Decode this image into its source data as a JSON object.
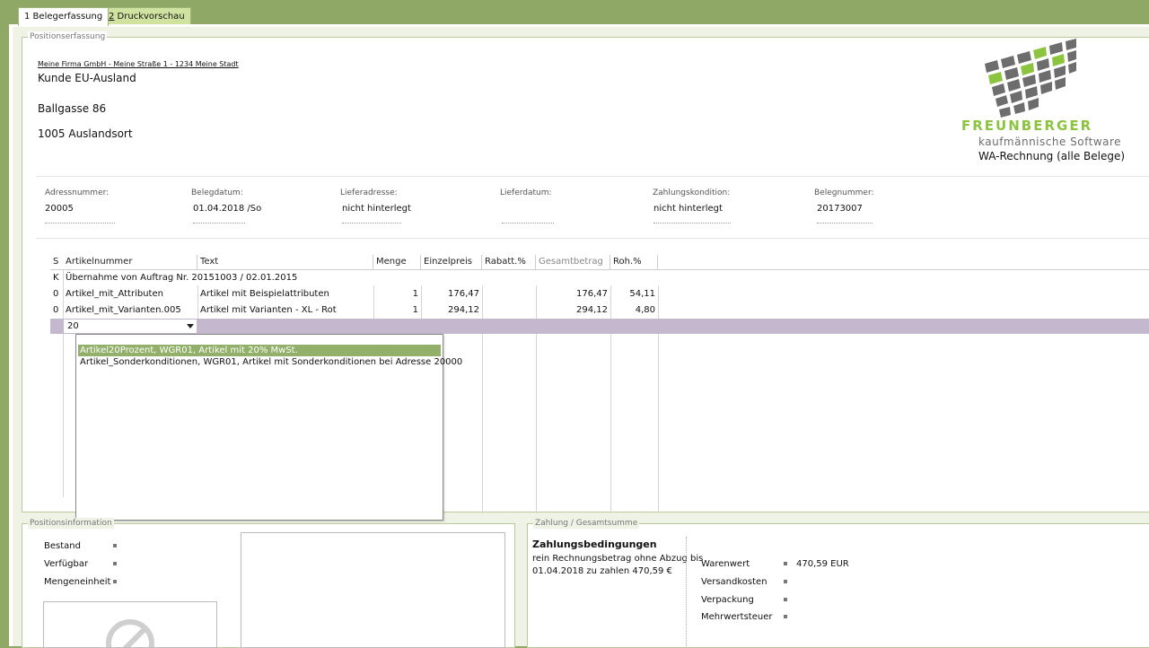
{
  "tabs": [
    {
      "hotkey": "1",
      "label": " Belegerfassung"
    },
    {
      "hotkey": "2",
      "label": " Druckvorschau"
    }
  ],
  "positionserfassung": {
    "title": "Positionserfassung",
    "sender_line": "Meine Firma GmbH - Meine Straße 1 - 1234 Meine Stadt",
    "customer_name": "Kunde EU-Ausland",
    "street": "Ballgasse 86",
    "city": "1005 Auslandsort",
    "logo": {
      "brand": "FREUNBERGER",
      "tagline": "kaufmännische Software",
      "colors": {
        "green": "#8cc43f",
        "grey": "#6d6d6d"
      }
    },
    "document_type": "WA-Rechnung (alle Belege)",
    "fields": [
      {
        "label": "Adressnummer:",
        "value": "20005"
      },
      {
        "label": "Belegdatum:",
        "value": "01.04.2018 /So"
      },
      {
        "label": "Lieferadresse:",
        "value": "nicht hinterlegt"
      },
      {
        "label": "Lieferdatum:",
        "value": ""
      },
      {
        "label": "Zahlungskondition:",
        "value": "nicht hinterlegt"
      },
      {
        "label": "Belegnummer:",
        "value": "20173007"
      }
    ]
  },
  "table": {
    "columns": [
      "S",
      "Artikelnummer",
      "Text",
      "Menge",
      "Einzelpreis",
      "Rabatt.%",
      "Gesamtbetrag",
      "Roh.%"
    ],
    "rows": [
      {
        "s": "K",
        "artikelnummer": "Übernahme von Auftrag Nr. 20151003 / 02.01.2015",
        "text": "",
        "menge": "",
        "einzelpreis": "",
        "rabatt": "",
        "gesamt": "",
        "roh": ""
      },
      {
        "s": "0",
        "artikelnummer": "Artikel_mit_Attributen",
        "text": "Artikel mit Beispielattributen",
        "menge": "1",
        "einzelpreis": "176,47",
        "rabatt": "",
        "gesamt": "176,47",
        "roh": "54,11"
      },
      {
        "s": "0",
        "artikelnummer": "Artikel_mit_Varianten.005",
        "text": "Artikel mit Varianten - XL - Rot",
        "menge": "1",
        "einzelpreis": "294,12",
        "rabatt": "",
        "gesamt": "294,12",
        "roh": "4,80"
      }
    ],
    "edit_row_value": "20",
    "dropdown_items": [
      "Artikel20Prozent, WGR01, Artikel mit 20% MwSt.",
      "Artikel_Sonderkonditionen, WGR01, Artikel mit Sonderkonditionen bei Adresse 20000"
    ]
  },
  "positionsinformation": {
    "title": "Positionsinformation",
    "items": [
      {
        "label": "Bestand"
      },
      {
        "label": "Verfügbar"
      },
      {
        "label": "Mengeneinheit"
      }
    ]
  },
  "zahlung": {
    "title": "Zahlung / Gesamtsumme",
    "heading": "Zahlungsbedingungen",
    "line1": "rein Rechnungsbetrag ohne Abzug bis",
    "line2": "01.04.2018 zu zahlen 470,59 €",
    "totals": [
      {
        "label": "Warenwert",
        "value": "470,59 EUR"
      },
      {
        "label": "Versandkosten",
        "value": ""
      },
      {
        "label": "Verpackung",
        "value": ""
      },
      {
        "label": "Mehrwertsteuer",
        "value": ""
      }
    ]
  },
  "colors": {
    "frame_green": "#8fa866",
    "selection_green": "#92b06a",
    "edit_row_purple": "#c4b8cf"
  }
}
